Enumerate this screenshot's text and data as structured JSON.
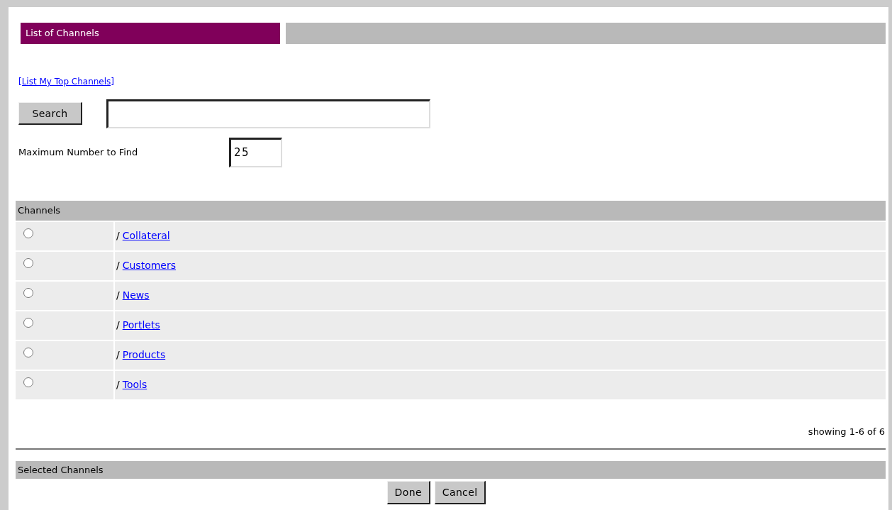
{
  "title": "List of Channels",
  "top_link": "[List My Top Channels]",
  "search": {
    "button": "Search"
  },
  "max_find": {
    "label": "Maximum Number to Find",
    "value": "25"
  },
  "channels": {
    "header": "Channels",
    "rows": [
      {
        "prefix": "/",
        "name": "Collateral",
        "selected": false
      },
      {
        "prefix": "/",
        "name": "Customers",
        "selected": false
      },
      {
        "prefix": "/",
        "name": "News",
        "selected": false
      },
      {
        "prefix": "/",
        "name": "Portlets",
        "selected": false
      },
      {
        "prefix": "/",
        "name": "Products",
        "selected": false
      },
      {
        "prefix": "/",
        "name": "Tools",
        "selected": false
      }
    ]
  },
  "showing": "showing 1-6 of 6",
  "selected_header": "Selected Channels",
  "buttons": [
    "Done",
    "Cancel"
  ]
}
